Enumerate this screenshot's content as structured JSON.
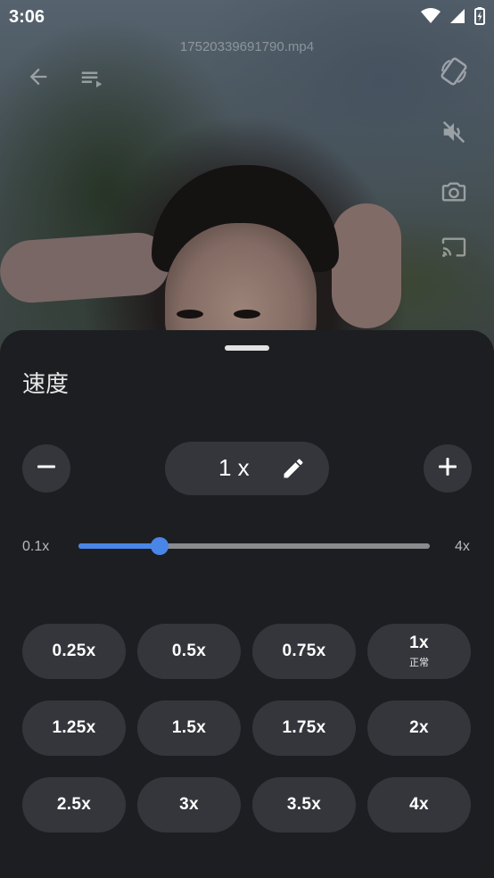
{
  "status_bar": {
    "time": "3:06"
  },
  "player": {
    "file_name": "17520339691790.mp4"
  },
  "sheet": {
    "title": "速度",
    "current_speed": "1 x",
    "slider": {
      "min_label": "0.1x",
      "max_label": "4x",
      "value": 1,
      "min": 0.1,
      "max": 4
    },
    "presets": [
      {
        "label": "0.25x",
        "sub": ""
      },
      {
        "label": "0.5x",
        "sub": ""
      },
      {
        "label": "0.75x",
        "sub": ""
      },
      {
        "label": "1x",
        "sub": "正常"
      },
      {
        "label": "1.25x",
        "sub": ""
      },
      {
        "label": "1.5x",
        "sub": ""
      },
      {
        "label": "1.75x",
        "sub": ""
      },
      {
        "label": "2x",
        "sub": ""
      },
      {
        "label": "2.5x",
        "sub": ""
      },
      {
        "label": "3x",
        "sub": ""
      },
      {
        "label": "3.5x",
        "sub": ""
      },
      {
        "label": "4x",
        "sub": ""
      }
    ]
  },
  "icons": {
    "back": "arrow-back-icon",
    "playlist": "playlist-icon",
    "rotate": "screen-rotation-icon",
    "mute": "volume-off-icon",
    "screenshot": "camera-icon",
    "cast": "cast-icon",
    "decrease": "minus-icon",
    "increase": "plus-icon",
    "edit": "pencil-icon"
  },
  "colors": {
    "accent": "#4a86e8",
    "sheet_bg": "#1d1e22",
    "chip_bg": "#34363b"
  }
}
